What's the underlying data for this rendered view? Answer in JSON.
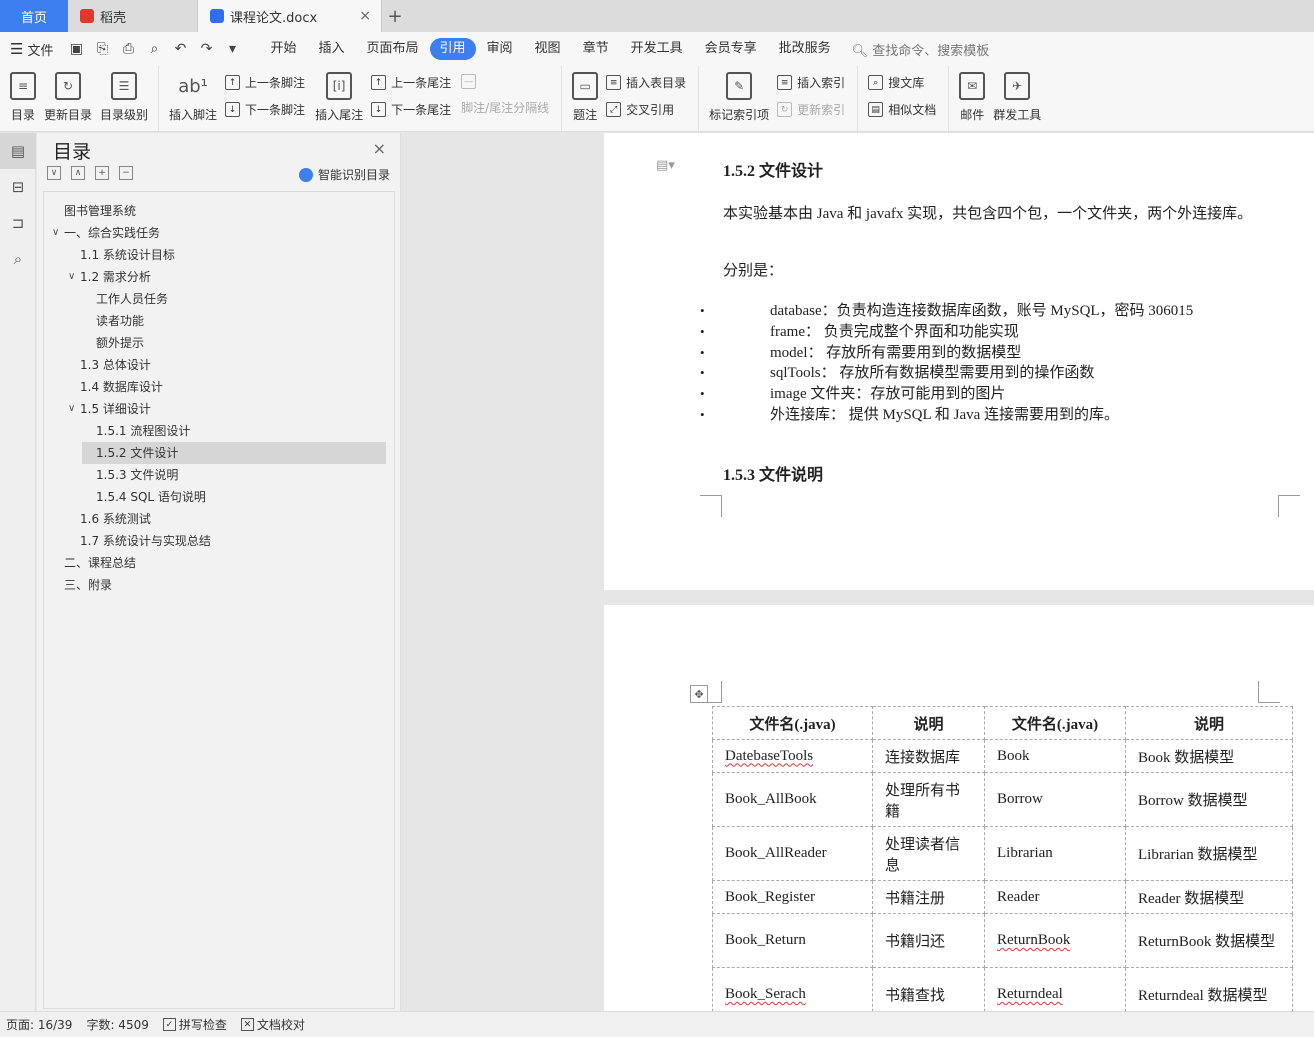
{
  "tabs": {
    "home": "首页",
    "daoke": "稻壳",
    "doc": "课程论文.docx"
  },
  "menu": {
    "file": "文件",
    "tabs": [
      "开始",
      "插入",
      "页面布局",
      "引用",
      "审阅",
      "视图",
      "章节",
      "开发工具",
      "会员专享",
      "批改服务"
    ],
    "active_tab": "引用",
    "search_placeholder": "查找命令、搜索模板"
  },
  "ribbon": {
    "toc": "目录",
    "update_toc": "更新目录",
    "toc_level": "目录级别",
    "insert_footnote": "插入脚注",
    "prev_footnote": "上一条脚注",
    "next_footnote": "下一条脚注",
    "insert_endnote": "插入尾注",
    "prev_endnote": "上一条尾注",
    "next_endnote": "下一条尾注",
    "separator": "脚注/尾注分隔线",
    "caption": "题注",
    "insert_table_of_figures": "插入表目录",
    "cross_reference": "交叉引用",
    "mark_index_entry": "标记索引项",
    "insert_index": "插入索引",
    "update_index": "更新索引",
    "search_library": "搜文库",
    "similar_docs": "相似文档",
    "mail": "邮件",
    "mass_tools": "群发工具"
  },
  "toc_panel": {
    "title": "目录",
    "smart": "智能识别目录",
    "items": [
      {
        "label": "图书管理系统",
        "level": 0,
        "chev": ""
      },
      {
        "label": "一、综合实践任务",
        "level": 0,
        "chev": "v"
      },
      {
        "label": "1.1  系统设计目标",
        "level": 1,
        "chev": ""
      },
      {
        "label": "1.2  需求分析",
        "level": 1,
        "chev": "v"
      },
      {
        "label": "工作人员任务",
        "level": 2,
        "chev": ""
      },
      {
        "label": "读者功能",
        "level": 2,
        "chev": ""
      },
      {
        "label": "额外提示",
        "level": 2,
        "chev": ""
      },
      {
        "label": "1.3  总体设计",
        "level": 1,
        "chev": ""
      },
      {
        "label": "1.4  数据库设计",
        "level": 1,
        "chev": ""
      },
      {
        "label": "1.5  详细设计",
        "level": 1,
        "chev": "v"
      },
      {
        "label": "1.5.1  流程图设计",
        "level": 2,
        "chev": ""
      },
      {
        "label": "1.5.2  文件设计",
        "level": 2,
        "chev": "",
        "selected": true
      },
      {
        "label": "1.5.3  文件说明",
        "level": 2,
        "chev": ""
      },
      {
        "label": "1.5.4 SQL  语句说明",
        "level": 2,
        "chev": ""
      },
      {
        "label": "1.6  系统测试",
        "level": 1,
        "chev": ""
      },
      {
        "label": "1.7  系统设计与实现总结",
        "level": 1,
        "chev": ""
      },
      {
        "label": "二、课程总结",
        "level": 0,
        "chev": ""
      },
      {
        "label": "三、附录",
        "level": 0,
        "chev": ""
      }
    ]
  },
  "document": {
    "heading_152": "1.5.2  文件设计",
    "para1": "本实验基本由 Java 和 javafx 实现，共包含四个包，一个文件夹，两个外连接库。",
    "para2": "分别是：",
    "bullets": [
      "database：负责构造连接数据库函数，账号 MySQL，密码 306015",
      "frame： 负责完成整个界面和功能实现",
      "model： 存放所有需要用到的数据模型",
      "sqlTools： 存放所有数据模型需要用到的操作函数",
      "image 文件夹：存放可能用到的图片",
      "外连接库： 提供 MySQL 和 Java 连接需要用到的库。"
    ],
    "heading_153": "1.5.3  文件说明",
    "table": {
      "headers": [
        "文件名(.java)",
        "说明",
        "文件名(.java)",
        "说明"
      ],
      "rows": [
        [
          "DatebaseTools",
          "连接数据库",
          "Book",
          "Book 数据模型"
        ],
        [
          "Book_AllBook",
          "处理所有书籍",
          "Borrow",
          "Borrow 数据模型"
        ],
        [
          "Book_AllReader",
          "处理读者信息",
          "Librarian",
          "Librarian 数据模型"
        ],
        [
          "Book_Register",
          "书籍注册",
          "Reader",
          "Reader 数据模型"
        ],
        [
          "Book_Return",
          "书籍归还",
          "ReturnBook",
          "ReturnBook 数据模型"
        ],
        [
          "Book_Serach",
          "书籍查找",
          "Returndeal",
          "Returndeal 数据模型"
        ]
      ]
    }
  },
  "status": {
    "page": "页面: 16/39",
    "words": "字数: 4509",
    "spell": "拼写检查",
    "proof": "文档校对"
  }
}
